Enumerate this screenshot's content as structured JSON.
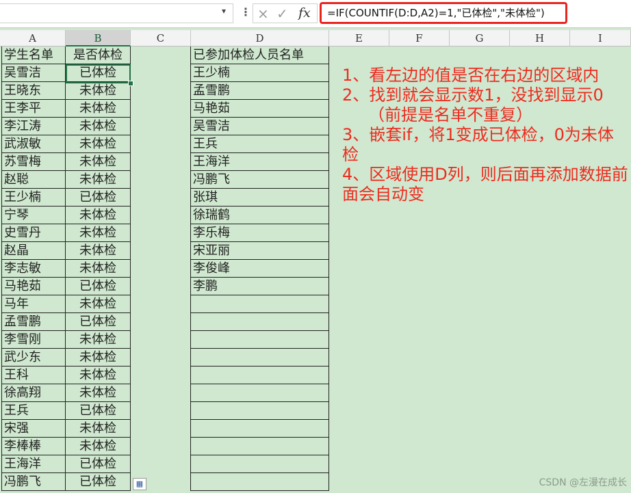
{
  "formula_bar": {
    "formula": "=IF(COUNTIF(D:D,A2)=1,\"已体检\",\"未体检\")",
    "more_icon": "vertical-dots",
    "cancel_icon": "×",
    "enter_icon": "✓",
    "fx_label": "fx"
  },
  "columns": [
    "A",
    "B",
    "C",
    "D",
    "E",
    "F",
    "G",
    "H",
    "I"
  ],
  "selected_column": "B",
  "table_headers": {
    "A": "学生名单",
    "B": "是否体检",
    "D": "已参加体检人员名单"
  },
  "students": [
    {
      "name": "吴雪洁",
      "status": "已体检"
    },
    {
      "name": "王晓东",
      "status": "未体检"
    },
    {
      "name": "王李平",
      "status": "未体检"
    },
    {
      "name": "李江涛",
      "status": "未体检"
    },
    {
      "name": "武淑敏",
      "status": "未体检"
    },
    {
      "name": "苏雪梅",
      "status": "未体检"
    },
    {
      "name": "赵聪",
      "status": "未体检"
    },
    {
      "name": "王少楠",
      "status": "已体检"
    },
    {
      "name": "宁琴",
      "status": "未体检"
    },
    {
      "name": "史雪丹",
      "status": "未体检"
    },
    {
      "name": "赵晶",
      "status": "未体检"
    },
    {
      "name": "李志敏",
      "status": "未体检"
    },
    {
      "name": "马艳茹",
      "status": "已体检"
    },
    {
      "name": "马年",
      "status": "未体检"
    },
    {
      "name": "孟雪鹏",
      "status": "已体检"
    },
    {
      "name": "李雪刚",
      "status": "未体检"
    },
    {
      "name": "武少东",
      "status": "未体检"
    },
    {
      "name": "王科",
      "status": "未体检"
    },
    {
      "name": "徐高翔",
      "status": "未体检"
    },
    {
      "name": "王兵",
      "status": "已体检"
    },
    {
      "name": "宋强",
      "status": "未体检"
    },
    {
      "name": "李棒棒",
      "status": "未体检"
    },
    {
      "name": "王海洋",
      "status": "已体检"
    },
    {
      "name": "冯鹏飞",
      "status": "已体检"
    }
  ],
  "attendees": [
    "王少楠",
    "孟雪鹏",
    "马艳茹",
    "吴雪洁",
    "王兵",
    "王海洋",
    "冯鹏飞",
    "张琪",
    "徐瑞鹤",
    "李乐梅",
    "宋亚丽",
    "李俊峰",
    "李鹏"
  ],
  "empty_attendee_rows": 11,
  "notes": [
    "1、看左边的值是否在右边的区域内",
    "2、找到就会显示数1，没找到显示0",
    "     （前提是名单不重复）",
    "3、嵌套if，将1变成已体检，0为未体检",
    "4、区域使用D列，则后面再添加数据前面会自动变"
  ],
  "paste_options_icon": "paste-options",
  "watermark": "CSDN @左漫在成长"
}
